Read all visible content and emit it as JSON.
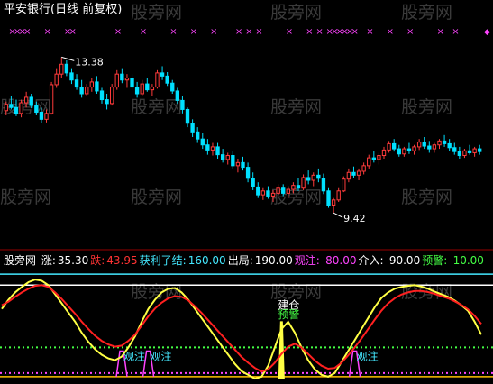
{
  "title": "平安银行(日线 前复权)",
  "watermark": "股旁网",
  "colors": {
    "up": "#ff3b3b",
    "down": "#00e0ff",
    "pink_marker": "#ff44ff",
    "white": "#ffffff",
    "yellow": "#ffff44",
    "red": "#ff2020",
    "cyan": "#44e8ff",
    "green": "#44ff44",
    "magenta": "#ff44ff",
    "gold": "#ffc000",
    "grid": "#990000"
  },
  "indicator_bar": {
    "name": "股旁网",
    "items": [
      {
        "label": "涨:",
        "value": "35.30",
        "label_color": "#ffffff",
        "value_color": "#ffffff"
      },
      {
        "label": "跌:",
        "value": "43.95",
        "label_color": "#ff3333",
        "value_color": "#ff3333"
      },
      {
        "label": "获利了结:",
        "value": "160.00",
        "label_color": "#44e8ff",
        "value_color": "#44e8ff"
      },
      {
        "label": "出局:",
        "value": "190.00",
        "label_color": "#ffffff",
        "value_color": "#ffffff"
      },
      {
        "label": "观注:",
        "value": "-80.00",
        "label_color": "#ff44ff",
        "value_color": "#ff44ff"
      },
      {
        "label": "介入:",
        "value": "-90.00",
        "label_color": "#ffffff",
        "value_color": "#ffffff"
      },
      {
        "label": "预警:",
        "value": "-10.00",
        "label_color": "#44ff44",
        "value_color": "#44ff44"
      }
    ]
  },
  "chart_data": [
    {
      "type": "candlestick",
      "title": "平安银行(日线 前复权)",
      "annotations": [
        {
          "text": "13.38",
          "type": "max",
          "value": 13.38
        },
        {
          "text": "9.42",
          "type": "min",
          "value": 9.42
        }
      ],
      "marker_rows": [
        "×",
        "◆"
      ],
      "ylim": [
        8.6,
        14.1
      ],
      "candles": [
        [
          12.02,
          12.25,
          11.9,
          12.18
        ],
        [
          12.18,
          12.4,
          12.05,
          12.1
        ],
        [
          12.1,
          12.3,
          11.88,
          11.95
        ],
        [
          11.95,
          12.3,
          11.85,
          12.22
        ],
        [
          12.22,
          12.5,
          12.1,
          12.36
        ],
        [
          12.36,
          12.45,
          12.08,
          12.15
        ],
        [
          12.15,
          12.25,
          11.9,
          11.98
        ],
        [
          11.98,
          12.1,
          11.7,
          11.8
        ],
        [
          11.8,
          12.05,
          11.72,
          11.95
        ],
        [
          11.95,
          12.75,
          11.92,
          12.68
        ],
        [
          12.68,
          13.1,
          12.6,
          12.95
        ],
        [
          12.95,
          13.38,
          12.85,
          13.2
        ],
        [
          13.2,
          13.3,
          12.9,
          12.98
        ],
        [
          12.98,
          13.1,
          12.7,
          12.8
        ],
        [
          12.8,
          12.95,
          12.55,
          12.62
        ],
        [
          12.62,
          12.8,
          12.35,
          12.45
        ],
        [
          12.45,
          12.7,
          12.4,
          12.62
        ],
        [
          12.62,
          12.85,
          12.5,
          12.75
        ],
        [
          12.75,
          12.9,
          12.45,
          12.52
        ],
        [
          12.52,
          12.6,
          12.2,
          12.3
        ],
        [
          12.3,
          12.45,
          12.05,
          12.2
        ],
        [
          12.2,
          12.7,
          12.15,
          12.62
        ],
        [
          12.62,
          13.05,
          12.55,
          12.95
        ],
        [
          12.95,
          13.1,
          12.72,
          12.8
        ],
        [
          12.8,
          12.95,
          12.6,
          12.85
        ],
        [
          12.85,
          12.95,
          12.55,
          12.62
        ],
        [
          12.62,
          12.75,
          12.35,
          12.45
        ],
        [
          12.45,
          12.8,
          12.4,
          12.7
        ],
        [
          12.7,
          12.85,
          12.5,
          12.55
        ],
        [
          12.55,
          12.7,
          12.4,
          12.62
        ],
        [
          12.62,
          13.05,
          12.58,
          12.98
        ],
        [
          12.98,
          13.15,
          12.8,
          12.9
        ],
        [
          12.9,
          13.0,
          12.65,
          12.72
        ],
        [
          12.72,
          12.8,
          12.45,
          12.52
        ],
        [
          12.52,
          12.6,
          12.2,
          12.28
        ],
        [
          12.28,
          12.4,
          11.95,
          12.05
        ],
        [
          12.05,
          12.1,
          11.6,
          11.7
        ],
        [
          11.7,
          11.8,
          11.35,
          11.48
        ],
        [
          11.48,
          11.6,
          11.2,
          11.3
        ],
        [
          11.3,
          11.45,
          11.05,
          11.15
        ],
        [
          11.15,
          11.3,
          10.9,
          11.02
        ],
        [
          11.02,
          11.2,
          10.88,
          11.1
        ],
        [
          11.1,
          11.2,
          10.8,
          10.9
        ],
        [
          10.9,
          11.05,
          10.7,
          10.78
        ],
        [
          10.78,
          10.95,
          10.65,
          10.88
        ],
        [
          10.88,
          11.0,
          10.55,
          10.62
        ],
        [
          10.62,
          10.8,
          10.45,
          10.7
        ],
        [
          10.7,
          10.85,
          10.5,
          10.58
        ],
        [
          10.58,
          10.7,
          10.2,
          10.3
        ],
        [
          10.3,
          10.45,
          10.0,
          10.08
        ],
        [
          10.08,
          10.2,
          9.8,
          9.88
        ],
        [
          9.88,
          10.05,
          9.75,
          9.98
        ],
        [
          9.98,
          10.1,
          9.78,
          9.85
        ],
        [
          9.85,
          10.0,
          9.7,
          9.92
        ],
        [
          9.92,
          10.15,
          9.85,
          10.05
        ],
        [
          10.05,
          10.15,
          9.85,
          9.92
        ],
        [
          9.92,
          10.1,
          9.8,
          10.02
        ],
        [
          10.02,
          10.2,
          9.92,
          10.12
        ],
        [
          10.12,
          10.3,
          9.98,
          10.05
        ],
        [
          10.05,
          10.4,
          10.0,
          10.32
        ],
        [
          10.32,
          10.5,
          10.15,
          10.25
        ],
        [
          10.25,
          10.45,
          10.1,
          10.38
        ],
        [
          10.38,
          10.55,
          10.2,
          10.3
        ],
        [
          10.3,
          10.42,
          9.9,
          9.98
        ],
        [
          9.98,
          10.05,
          9.55,
          9.62
        ],
        [
          9.62,
          9.8,
          9.42,
          9.75
        ],
        [
          9.75,
          10.05,
          9.7,
          9.98
        ],
        [
          9.98,
          10.35,
          9.95,
          10.28
        ],
        [
          10.28,
          10.55,
          10.2,
          10.45
        ],
        [
          10.45,
          10.6,
          10.3,
          10.38
        ],
        [
          10.38,
          10.55,
          10.25,
          10.48
        ],
        [
          10.48,
          10.7,
          10.4,
          10.62
        ],
        [
          10.62,
          10.9,
          10.55,
          10.82
        ],
        [
          10.82,
          11.0,
          10.7,
          10.78
        ],
        [
          10.78,
          10.95,
          10.65,
          10.88
        ],
        [
          10.88,
          11.1,
          10.8,
          11.02
        ],
        [
          11.02,
          11.25,
          10.95,
          11.18
        ],
        [
          11.18,
          11.3,
          10.98,
          11.05
        ],
        [
          11.05,
          11.15,
          10.85,
          10.92
        ],
        [
          10.92,
          11.1,
          10.85,
          11.05
        ],
        [
          11.05,
          11.2,
          10.92,
          11.0
        ],
        [
          11.0,
          11.15,
          10.9,
          11.1
        ],
        [
          11.1,
          11.3,
          11.02,
          11.22
        ],
        [
          11.22,
          11.35,
          11.05,
          11.12
        ],
        [
          11.12,
          11.25,
          10.95,
          11.05
        ],
        [
          11.05,
          11.2,
          10.95,
          11.15
        ],
        [
          11.15,
          11.3,
          11.05,
          11.25
        ],
        [
          11.25,
          11.4,
          11.1,
          11.18
        ],
        [
          11.18,
          11.3,
          11.0,
          11.08
        ],
        [
          11.08,
          11.2,
          10.9,
          10.98
        ],
        [
          10.98,
          11.1,
          10.8,
          10.88
        ],
        [
          10.88,
          11.05,
          10.82,
          11.0
        ],
        [
          11.0,
          11.15,
          10.9,
          10.95
        ],
        [
          10.95,
          11.1,
          10.85,
          11.05
        ],
        [
          11.05,
          11.15,
          10.9,
          10.98
        ]
      ]
    },
    {
      "type": "line",
      "subtitle": "股旁网",
      "ylim": [
        -100,
        200
      ],
      "hlines": [
        {
          "value": 190,
          "label": "出局",
          "color": "#44e8ff"
        },
        {
          "value": 160,
          "label": "获利了结",
          "color": "#ffffff"
        },
        {
          "value": -10,
          "label": "预警",
          "color": "#44ff44",
          "style": "dotted"
        },
        {
          "value": -80,
          "label": "观注",
          "color": "#ff44ff",
          "style": "dotted"
        },
        {
          "value": -90,
          "label": "介入",
          "color": "#ffc000"
        }
      ],
      "series": [
        {
          "label": "涨",
          "color": "#ffff44",
          "values": [
            95,
            120,
            140,
            155,
            168,
            175,
            172,
            160,
            135,
            110,
            85,
            60,
            30,
            5,
            -15,
            -30,
            -40,
            -45,
            -35,
            -10,
            20,
            60,
            95,
            120,
            140,
            150,
            152,
            140,
            120,
            95,
            70,
            45,
            20,
            -5,
            -30,
            -55,
            -75,
            -85,
            -95,
            -90,
            -60,
            -10,
            40,
            60,
            30,
            -10,
            -45,
            -70,
            -85,
            -90,
            -80,
            -50,
            -20,
            10,
            40,
            70,
            100,
            125,
            140,
            150,
            155,
            158,
            160,
            156,
            150,
            142,
            135,
            128,
            118,
            105,
            90,
            60,
            25
          ]
        },
        {
          "label": "跌",
          "color": "#ff2020",
          "values": [
            105,
            115,
            128,
            140,
            150,
            158,
            160,
            155,
            140,
            122,
            102,
            82,
            60,
            40,
            22,
            8,
            -2,
            -8,
            -5,
            8,
            25,
            50,
            75,
            96,
            112,
            124,
            130,
            128,
            118,
            102,
            84,
            64,
            44,
            24,
            4,
            -16,
            -36,
            -52,
            -66,
            -76,
            -70,
            -52,
            -28,
            -8,
            0,
            -10,
            -28,
            -46,
            -60,
            -68,
            -66,
            -52,
            -32,
            -10,
            14,
            40,
            66,
            90,
            110,
            124,
            134,
            140,
            144,
            144,
            141,
            136,
            130,
            124,
            116,
            106,
            94,
            76,
            54
          ]
        }
      ],
      "annotations": [
        {
          "text": "建仓",
          "color": "#ffffff",
          "x_index": 42
        },
        {
          "text": "预警",
          "color": "#44ff44",
          "x_index": 42
        },
        {
          "text": "观注",
          "color": "#44e8ff",
          "x_index": 18
        },
        {
          "text": "观注",
          "color": "#44e8ff",
          "x_index": 22
        },
        {
          "text": "观注",
          "color": "#44e8ff",
          "x_index": 53
        }
      ]
    }
  ]
}
